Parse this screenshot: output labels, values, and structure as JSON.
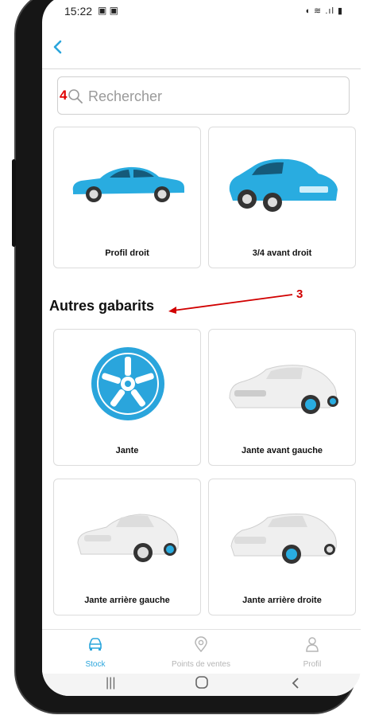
{
  "status": {
    "time": "15:22",
    "left_icons": "▣ ▣",
    "right_icons": "◖ ≋ .ıl ▮"
  },
  "header": {
    "back_label": "‹"
  },
  "search": {
    "placeholder": "Rechercher",
    "value": "",
    "annotation": "4"
  },
  "top_cards": [
    {
      "label": "Profil droit",
      "icon": "car-side-profile-blue"
    },
    {
      "label": "3/4 avant droit",
      "icon": "car-three-quarter-blue"
    }
  ],
  "section": {
    "title": "Autres gabarits",
    "annotation": "3"
  },
  "cards": [
    {
      "label": "Jante",
      "icon": "wheel-rim-blue"
    },
    {
      "label": "Jante avant gauche",
      "icon": "car-front-left-rim"
    },
    {
      "label": "Jante arrière gauche",
      "icon": "car-rear-left-rim"
    },
    {
      "label": "Jante arrière droite",
      "icon": "car-rear-right-rim"
    }
  ],
  "nav": {
    "items": [
      {
        "label": "Stock",
        "icon": "car-icon",
        "active": true
      },
      {
        "label": "Points de ventes",
        "icon": "location-pin-icon",
        "active": false
      },
      {
        "label": "Profil",
        "icon": "user-icon",
        "active": false
      }
    ]
  },
  "colors": {
    "accent": "#2aa5dc",
    "car_blue": "#29ace0",
    "annotation_red": "#d10000",
    "inactive": "#b5b5b5"
  }
}
